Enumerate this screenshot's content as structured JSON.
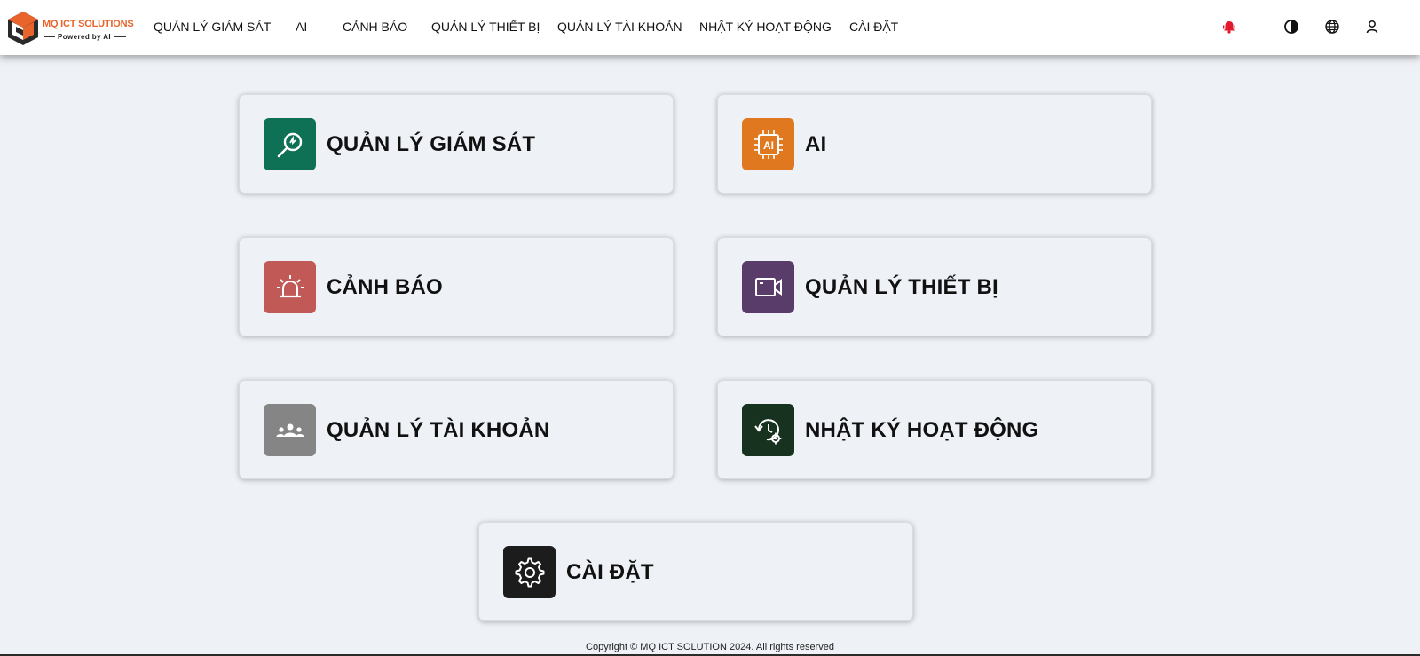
{
  "header": {
    "brand": {
      "name": "MQ ICT SOLUTIONS",
      "tagline": "Powered by AI"
    },
    "nav": [
      {
        "label": "QUẢN LÝ GIÁM SÁT"
      },
      {
        "label": "AI"
      },
      {
        "label": "CẢNH BÁO"
      },
      {
        "label": "QUẢN LÝ THIẾT BỊ"
      },
      {
        "label": "QUẢN LÝ TÀI KHOẢN"
      },
      {
        "label": "NHẬT KÝ HOẠT ĐỘNG"
      },
      {
        "label": "CÀI ĐẶT"
      }
    ],
    "icons": [
      "notification-bell-icon",
      "theme-contrast-icon",
      "language-globe-icon",
      "user-account-icon"
    ]
  },
  "cards": [
    {
      "label": "QUẢN LÝ GIÁM SÁT",
      "icon": "search-monitor-icon",
      "color": "#0e7054"
    },
    {
      "label": "AI",
      "icon": "ai-chip-icon",
      "color": "#e0781f"
    },
    {
      "label": "CẢNH BÁO",
      "icon": "siren-alarm-icon",
      "color": "#c15a57"
    },
    {
      "label": "QUẢN LÝ THIẾT BỊ",
      "icon": "video-camera-icon",
      "color": "#5a3c6b"
    },
    {
      "label": "QUẢN LÝ TÀI KHOẢN",
      "icon": "users-group-icon",
      "color": "#858585"
    },
    {
      "label": "NHẬT KÝ HOẠT ĐỘNG",
      "icon": "history-settings-icon",
      "color": "#17321f"
    },
    {
      "label": "CÀI ĐẶT",
      "icon": "gear-icon",
      "color": "#1c1c1c"
    }
  ],
  "footer": {
    "copyright": "Copyright © MQ ICT SOLUTION 2024. All rights reserved"
  },
  "colors": {
    "background": "#eef1f6",
    "bell": "#e3172b",
    "brand_orange": "#e8642c"
  }
}
